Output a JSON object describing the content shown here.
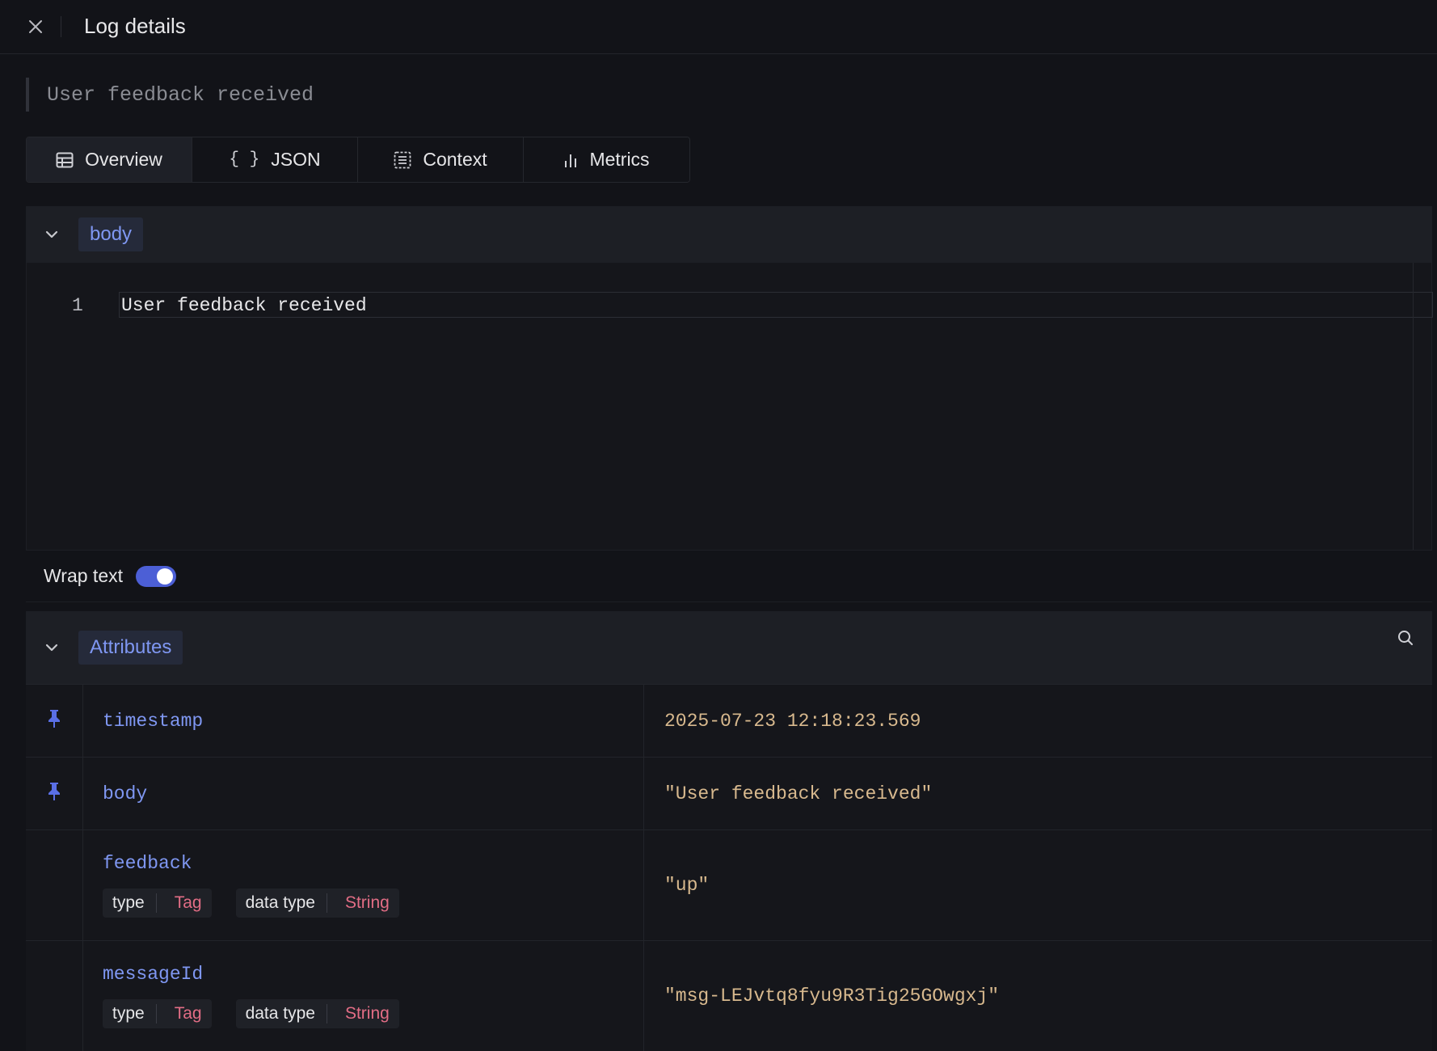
{
  "header": {
    "title": "Log details",
    "close_icon": "close-icon"
  },
  "summary": "User feedback received",
  "tabs": [
    {
      "label": "Overview",
      "icon": "table-icon",
      "active": true
    },
    {
      "label": "JSON",
      "icon": "braces-icon",
      "active": false
    },
    {
      "label": "Context",
      "icon": "list-icon",
      "active": false
    },
    {
      "label": "Metrics",
      "icon": "bar-chart-icon",
      "active": false
    }
  ],
  "body_section": {
    "label": "body",
    "line_number": "1",
    "content": "User feedback received",
    "wrap_label": "Wrap text",
    "wrap_enabled": true
  },
  "attributes_section": {
    "label": "Attributes",
    "rows": [
      {
        "key": "timestamp",
        "value": "2025-07-23 12:18:23.569",
        "pinned": true
      },
      {
        "key": "body",
        "value": "\"User feedback received\"",
        "pinned": true
      },
      {
        "key": "feedback",
        "value": "\"up\"",
        "pinned": false,
        "type_label": "type",
        "type_value": "Tag",
        "dtype_label": "data type",
        "dtype_value": "String"
      },
      {
        "key": "messageId",
        "value": "\"msg-LEJvtq8fyu9R3Tig25GOwgxj\"",
        "pinned": false,
        "type_label": "type",
        "type_value": "Tag",
        "dtype_label": "data type",
        "dtype_value": "String"
      }
    ]
  },
  "colors": {
    "background": "#121318",
    "accent": "#4c5fd6",
    "key_text": "#7f97f2",
    "value_text": "#d8b98e",
    "chip_value": "#e26d85"
  }
}
